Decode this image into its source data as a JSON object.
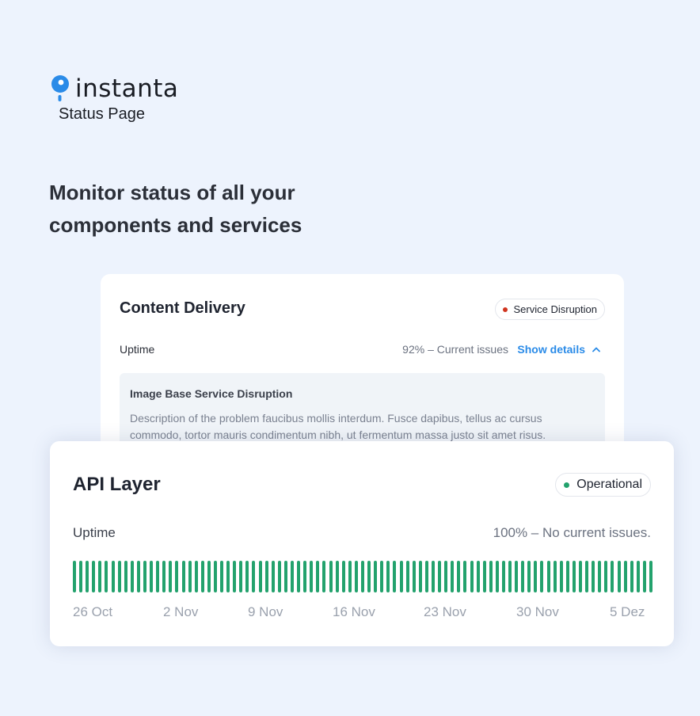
{
  "brand": {
    "name": "instanta",
    "subtitle": "Status Page",
    "accent": "#2a8be8"
  },
  "headline": "Monitor status of all your components and services",
  "content_delivery": {
    "title": "Content Delivery",
    "status": "Service Disruption",
    "status_color": "#d0341f",
    "uptime_label": "Uptime",
    "uptime_status": "92% – Current issues",
    "details_toggle": "Show details",
    "issue": {
      "title": "Image Base Service Disruption",
      "description": "Description of the problem faucibus mollis interdum. Fusce dapibus, tellus ac cursus commodo, tortor mauris condimentum nibh, ut fermentum massa justo sit amet risus."
    }
  },
  "api_layer": {
    "title": "API Layer",
    "status": "Operational",
    "status_color": "#23a26d",
    "uptime_label": "Uptime",
    "uptime_status": "100% – No current issues.",
    "days_shown": 91,
    "days_operational": 91,
    "dates": [
      "26 Oct",
      "2 Nov",
      "9 Nov",
      "16 Nov",
      "23 Nov",
      "30 Nov",
      "5 Dez"
    ]
  }
}
